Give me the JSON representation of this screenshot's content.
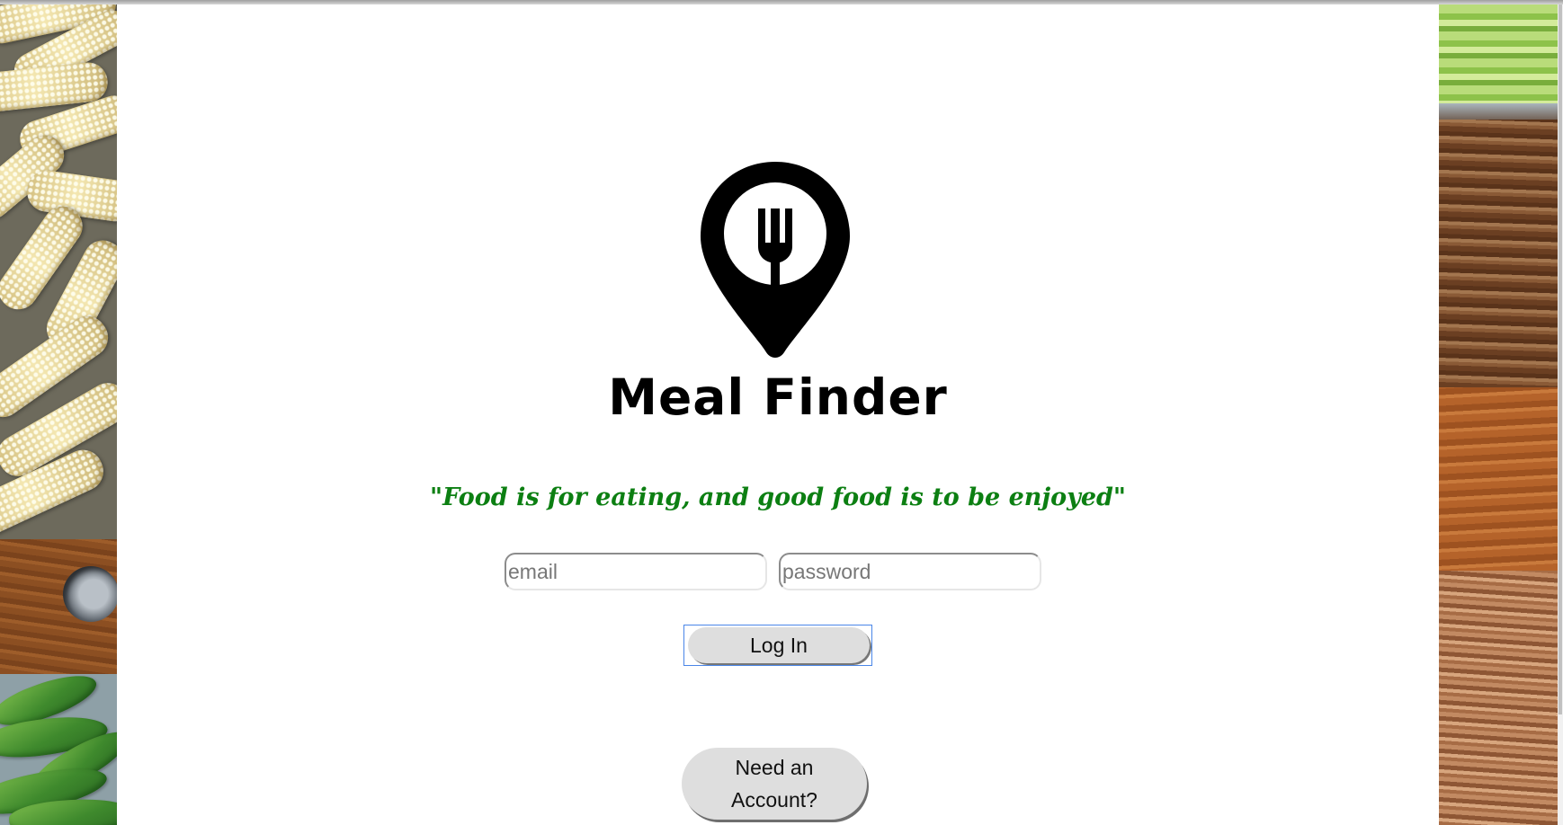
{
  "app": {
    "name": "Meal Finder",
    "tagline": "\"Food is for eating, and good food is to be enjoyed\""
  },
  "login_form": {
    "email_placeholder": "email",
    "email_value": "",
    "password_placeholder": "password",
    "password_value": "",
    "login_label": "Log In",
    "signup_label": "Need an Account?"
  },
  "icons": {
    "logo": "location-pin-fork-icon"
  },
  "colors": {
    "tagline": "#0c7f12",
    "button_background": "#dedede",
    "focus_ring": "#4a86e8",
    "page_background": "#ffffff"
  }
}
